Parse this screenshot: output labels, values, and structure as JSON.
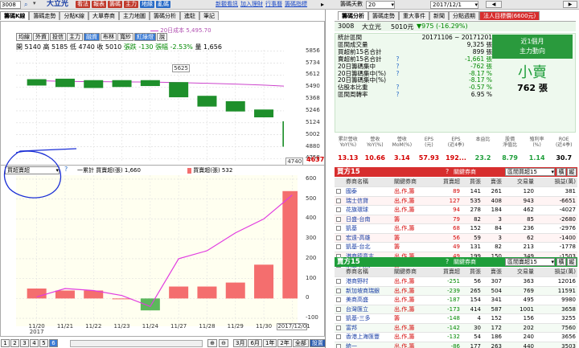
{
  "topbar": {
    "code": "3008",
    "name": "大立光",
    "buttons": [
      "看法",
      "報表",
      "籌碼",
      "主力",
      "地緣",
      "亂碼"
    ],
    "links": [
      "新觀看訊",
      "加入理財",
      "行事曆",
      "籌碼指標"
    ],
    "right_label": "籌碼天數",
    "right_days": "20",
    "date_field": "2017/12/1"
  },
  "left_tabs": [
    "籌碼K線",
    "籌碼走勢",
    "分點K線",
    "大單券商",
    "主力地圖",
    "籌碼分析",
    "進駐",
    "筆記"
  ],
  "chart_buttons": [
    "均線",
    "外資",
    "投信",
    "主力",
    "融資",
    "布林",
    "寬紗",
    "紅綠燈",
    "說"
  ],
  "ohlc": {
    "open_label": "開",
    "open": "5140",
    "high_label": "高",
    "high": "5185",
    "low_label": "低",
    "low": "4740",
    "close_label": "收",
    "close": "5010",
    "change_label": "張跌",
    "change": "-130",
    "pct_label": "張幅",
    "pct": "-2.53%",
    "vol_label": "量",
    "vol": "1,656"
  },
  "ma_label": "20日成本 5,495.70",
  "y_top": [
    "5856",
    "5734",
    "5612",
    "5490",
    "5368",
    "5246",
    "5124",
    "5002",
    "4880",
    "4758"
  ],
  "price_marker_top": "5625",
  "price_marker_bottom": "4740",
  "price_red_label": "4637",
  "lower_legend": {
    "select": "買超賣超",
    "series1": "一累計 買賣超(張) 1,660",
    "series2": "買賣超(張) 532"
  },
  "y_bottom": [
    "600",
    "500",
    "400",
    "300",
    "200",
    "100",
    "0",
    "-100"
  ],
  "x_dates": [
    "11/20\n2017",
    "11/21",
    "11/22",
    "11/23",
    "11/24",
    "11/27",
    "11/28",
    "11/29",
    "11/30",
    "2017/12/01"
  ],
  "bottom_bar": {
    "pages": [
      "1",
      "2",
      "3",
      "4",
      "5",
      "6"
    ],
    "ranges": [
      "3月",
      "6月",
      "1年",
      "2年",
      "全部",
      "設置"
    ]
  },
  "chart_data": {
    "type": "bar",
    "categories": [
      "11/20",
      "11/21",
      "11/22",
      "11/23",
      "11/24",
      "11/27",
      "11/28",
      "11/29",
      "11/30",
      "12/01"
    ],
    "candles": [
      {
        "o": 5570,
        "c": 5505
      },
      {
        "o": 5575,
        "c": 5490
      },
      {
        "o": 5560,
        "c": 5480
      },
      {
        "o": 5560,
        "c": 5490
      },
      {
        "o": 5560,
        "c": 5500
      },
      {
        "o": 5540,
        "c": 5385
      },
      {
        "o": 5400,
        "c": 5290
      },
      {
        "o": 5345,
        "c": 5240
      },
      {
        "o": 5260,
        "c": 5180
      },
      {
        "o": 5140,
        "c": 4880
      }
    ],
    "ma20": [
      5555,
      5548,
      5545,
      5542,
      5540,
      5535,
      5528,
      5520,
      5510,
      5495
    ],
    "price_ylim": [
      4720,
      5870
    ],
    "series": [
      {
        "name": "買賣超(張)",
        "values": [
          50,
          40,
          40,
          0,
          -60,
          60,
          60,
          80,
          170,
          540
        ]
      },
      {
        "name": "累計 買賣超(張)",
        "values": [
          8,
          50,
          40,
          15,
          -40,
          200,
          240,
          330,
          400,
          520
        ]
      }
    ],
    "ylim": [
      -140,
      620
    ]
  },
  "right_tabs": [
    "籌碼分析",
    "籌碼走勢",
    "重大事件",
    "新聞",
    "分點週期",
    "法人目標價(6600元)"
  ],
  "quote": {
    "code": "3008",
    "name": "大立光",
    "price": "5010元",
    "change": "▼975 (-16.29%)"
  },
  "stats": [
    {
      "label": "統計區間",
      "value": "20171106 ~ 20171201"
    },
    {
      "label": "區間成交量",
      "value": "9,325 張"
    },
    {
      "label": "買超前15名合計",
      "value": "899 張"
    },
    {
      "label": "賣超前15名合計",
      "value": "-1,661 張"
    },
    {
      "label": "20日籌碼集中",
      "value": "-762 張"
    },
    {
      "label": "20日籌碼集中(%)",
      "value": "-8.17 %"
    },
    {
      "label": "20日籌碼集中(%)",
      "value": "-8.17 %"
    },
    {
      "label": "佔股本比重",
      "value": "-0.57 %"
    },
    {
      "label": "區間周轉率",
      "value": "6.95 %"
    }
  ],
  "summary_box": {
    "title1": "近1個月",
    "title2": "主力動向",
    "status": "小賣",
    "amount": "762 張"
  },
  "metrics": {
    "headers": [
      "累計營收\nYoY(%)",
      "營收\nYoY(%)",
      "營收\nMoM(%)",
      "EPS\n(元)",
      "EPS\n(近4季)",
      "本益比",
      "股價\n淨值比",
      "殖利率\n(%)",
      "ROE\n(近4季)"
    ],
    "values": [
      "13.13",
      "10.66",
      "3.14",
      "57.93",
      "192...",
      "23.2",
      "8.79",
      "1.14",
      "30.7"
    ]
  },
  "buy": {
    "title": "買方15",
    "link": "關鍵券商",
    "select": "區間買超15",
    "toggle1": "橫",
    "toggle2": "縱",
    "headers": [
      "券商名稱",
      "關鍵券商",
      "買賣超",
      "買張",
      "賣張",
      "交易量",
      "損益(萬)"
    ],
    "rows": [
      [
        "國泰",
        "出,作,籌",
        "89",
        "141",
        "261",
        "120",
        "381",
        "-5884"
      ],
      [
        "瑞士信貸",
        "出,作,籌",
        "127",
        "535",
        "408",
        "943",
        "-6651"
      ],
      [
        "花旗環球",
        "出,作,籌",
        "94",
        "278",
        "184",
        "462",
        "-4027"
      ],
      [
        "日盛-台南",
        "籌",
        "79",
        "82",
        "3",
        "85",
        "-2680"
      ],
      [
        "凱基",
        "出,作,籌",
        "68",
        "152",
        "84",
        "236",
        "-2976"
      ],
      [
        "宏遠-高雄",
        "籌",
        "56",
        "59",
        "3",
        "62",
        "-1400"
      ],
      [
        "凱基-台北",
        "籌",
        "49",
        "131",
        "82",
        "213",
        "-1778"
      ],
      [
        "港商德意志",
        "出,作,籌",
        "49",
        "199",
        "150",
        "349",
        "-1503"
      ],
      [
        "永豐-內湖",
        "籌",
        "48",
        "48",
        "0",
        "48",
        "-1497"
      ]
    ]
  },
  "sell": {
    "title": "賣方15",
    "link": "關鍵券商",
    "select": "區間賣超15",
    "toggle1": "橫",
    "toggle2": "縱",
    "headers": [
      "券商名稱",
      "關鍵券商",
      "買賣超",
      "買張",
      "賣張",
      "交易量",
      "損益(萬)"
    ],
    "rows": [
      [
        "港商野村",
        "出,作,籌",
        "-251",
        "56",
        "307",
        "363",
        "12016"
      ],
      [
        "新加坡商瑞銀",
        "出,作,籌",
        "-239",
        "265",
        "504",
        "769",
        "11591"
      ],
      [
        "美商高盛",
        "出,作,籌",
        "-187",
        "154",
        "341",
        "495",
        "9980"
      ],
      [
        "台灣匯立",
        "出,作,籌",
        "-173",
        "414",
        "587",
        "1001",
        "3658"
      ],
      [
        "凱基-三多",
        "籌",
        "-148",
        "4",
        "152",
        "156",
        "3255"
      ],
      [
        "富邦",
        "出,作,籌",
        "-142",
        "30",
        "172",
        "202",
        "7560"
      ],
      [
        "香港上海匯豐",
        "出,作,籌",
        "-132",
        "54",
        "186",
        "240",
        "3656"
      ],
      [
        "統一",
        "出,作,籌",
        "-86",
        "177",
        "263",
        "440",
        "3503"
      ],
      [
        "港商麥格理",
        "出,作,籌",
        "-82",
        "124",
        "207",
        "331",
        "-1091"
      ]
    ]
  }
}
